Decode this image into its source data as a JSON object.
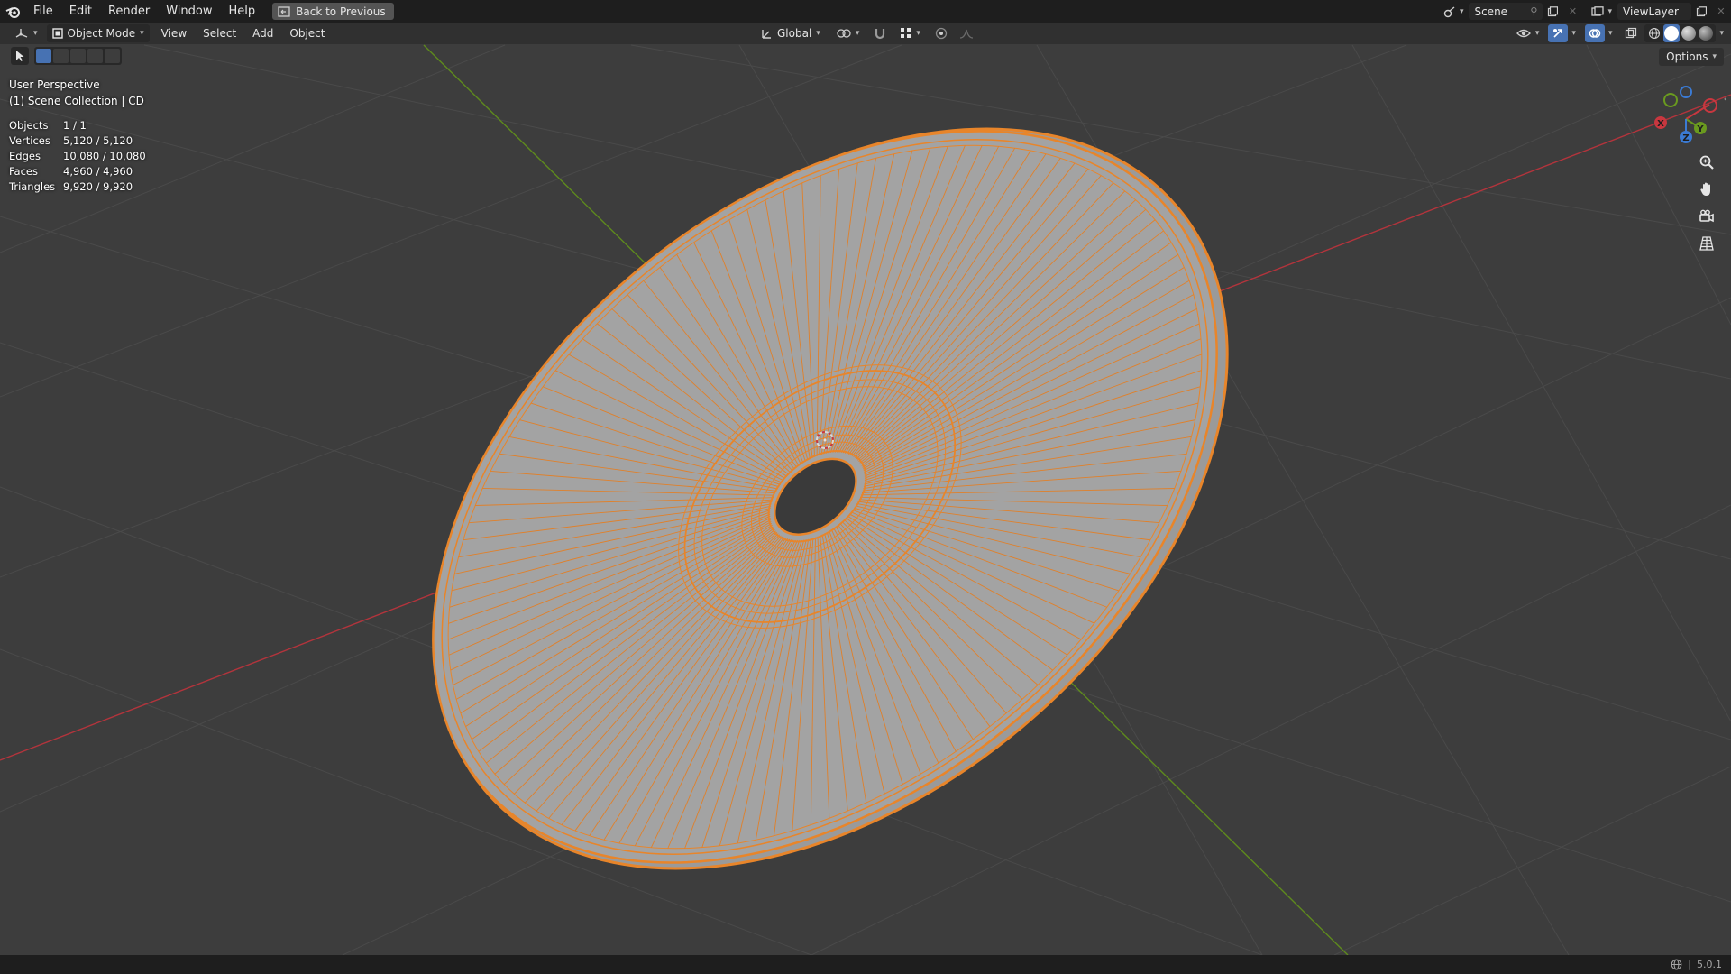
{
  "menu": {
    "file": "File",
    "edit": "Edit",
    "render": "Render",
    "window": "Window",
    "help": "Help",
    "back_to_previous": "Back to Previous"
  },
  "top_right": {
    "scene_name": "Scene",
    "view_layer": "ViewLayer"
  },
  "header": {
    "mode": "Object Mode",
    "view": "View",
    "select": "Select",
    "add": "Add",
    "object": "Object",
    "transform_orientation": "Global",
    "options": "Options"
  },
  "overlay": {
    "view_name": "User Perspective",
    "collection": "(1) Scene Collection | CD",
    "stats": [
      {
        "label": "Objects",
        "value": "1 / 1"
      },
      {
        "label": "Vertices",
        "value": "5,120 / 5,120"
      },
      {
        "label": "Edges",
        "value": "10,080 / 10,080"
      },
      {
        "label": "Faces",
        "value": "4,960 / 4,960"
      },
      {
        "label": "Triangles",
        "value": "9,920 / 9,920"
      }
    ]
  },
  "gizmo": {
    "x": "X",
    "y": "Y",
    "z": "Z"
  },
  "status": {
    "version": "5.0.1"
  },
  "colors": {
    "selection_outline": "#e8852a",
    "x_axis": "#c8373f",
    "y_axis": "#6a9a1f",
    "z_axis": "#3b7bd4",
    "active_button": "#4772b3"
  }
}
